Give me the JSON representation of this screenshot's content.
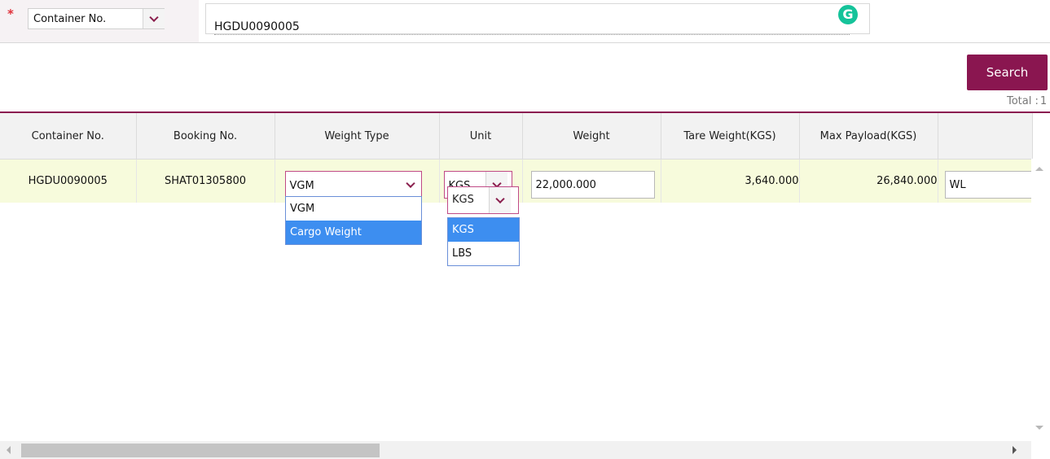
{
  "search": {
    "required_mark": "*",
    "key_field": "Container No.",
    "value": "HGDU0090005",
    "grammarly_badge": "G",
    "search_label": "Search",
    "total_label": "Total :",
    "total_count": "1"
  },
  "grid": {
    "columns": [
      "Container No.",
      "Booking No.",
      "Weight Type",
      "Unit",
      "Weight",
      "Tare Weight(KGS)",
      "Max Payload(KGS)",
      ""
    ],
    "row": {
      "container_no": "HGDU0090005",
      "booking_no": "SHAT01305800",
      "weight_type": "VGM",
      "unit": "KGS",
      "weight": "22,000.000",
      "tare_weight": "3,640.000",
      "max_payload": "26,840.000",
      "extra": "WL"
    }
  },
  "weight_type_dropdown": {
    "options": [
      "VGM",
      "Cargo Weight"
    ],
    "highlighted": "Cargo Weight"
  },
  "unit_dropdown": {
    "current": "KGS",
    "options": [
      "KGS",
      "LBS"
    ],
    "highlighted": "KGS"
  },
  "icons": {
    "chevron": "chevron-down-icon",
    "scroll_up": "scroll-up-arrow-icon",
    "scroll_down": "scroll-down-arrow-icon",
    "scroll_left": "scroll-left-arrow-icon",
    "scroll_right": "scroll-right-arrow-icon"
  },
  "colors": {
    "accent": "#8a1650",
    "row_highlight": "#f7fbdc",
    "selection": "#3d8ef0",
    "grammarly": "#15c39a"
  }
}
